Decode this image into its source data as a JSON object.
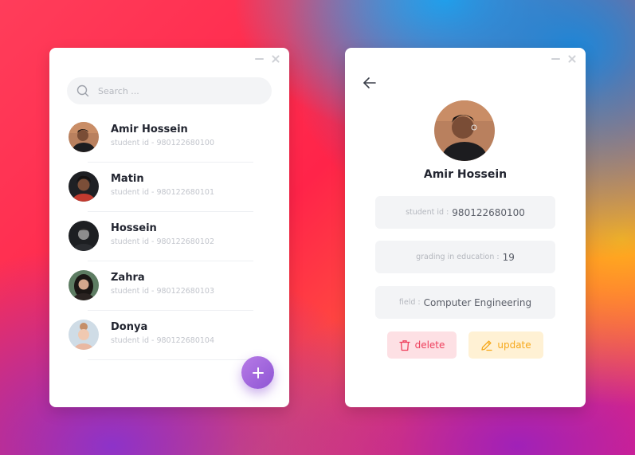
{
  "list_window": {
    "search": {
      "placeholder": "Search ..."
    },
    "students": [
      {
        "name": "Amir Hossein",
        "id_text": "student id - 980122680100"
      },
      {
        "name": "Matin",
        "id_text": "student id - 980122680101"
      },
      {
        "name": "Hossein",
        "id_text": "student id - 980122680102"
      },
      {
        "name": "Zahra",
        "id_text": "student id - 980122680103"
      },
      {
        "name": "Donya",
        "id_text": "student id - 980122680104"
      }
    ],
    "add_button_icon": "plus-icon"
  },
  "detail_window": {
    "name": "Amir Hossein",
    "fields": [
      {
        "label": "student id :",
        "value": "980122680100"
      },
      {
        "label": "grading in education :",
        "value": "19"
      },
      {
        "label": "field :",
        "value": "Computer Engineering"
      }
    ],
    "delete_label": "delete",
    "update_label": "update"
  },
  "colors": {
    "accent_purple": "#9a5fdc",
    "delete_red": "#ee3f5c",
    "update_orange": "#f6a81b"
  }
}
